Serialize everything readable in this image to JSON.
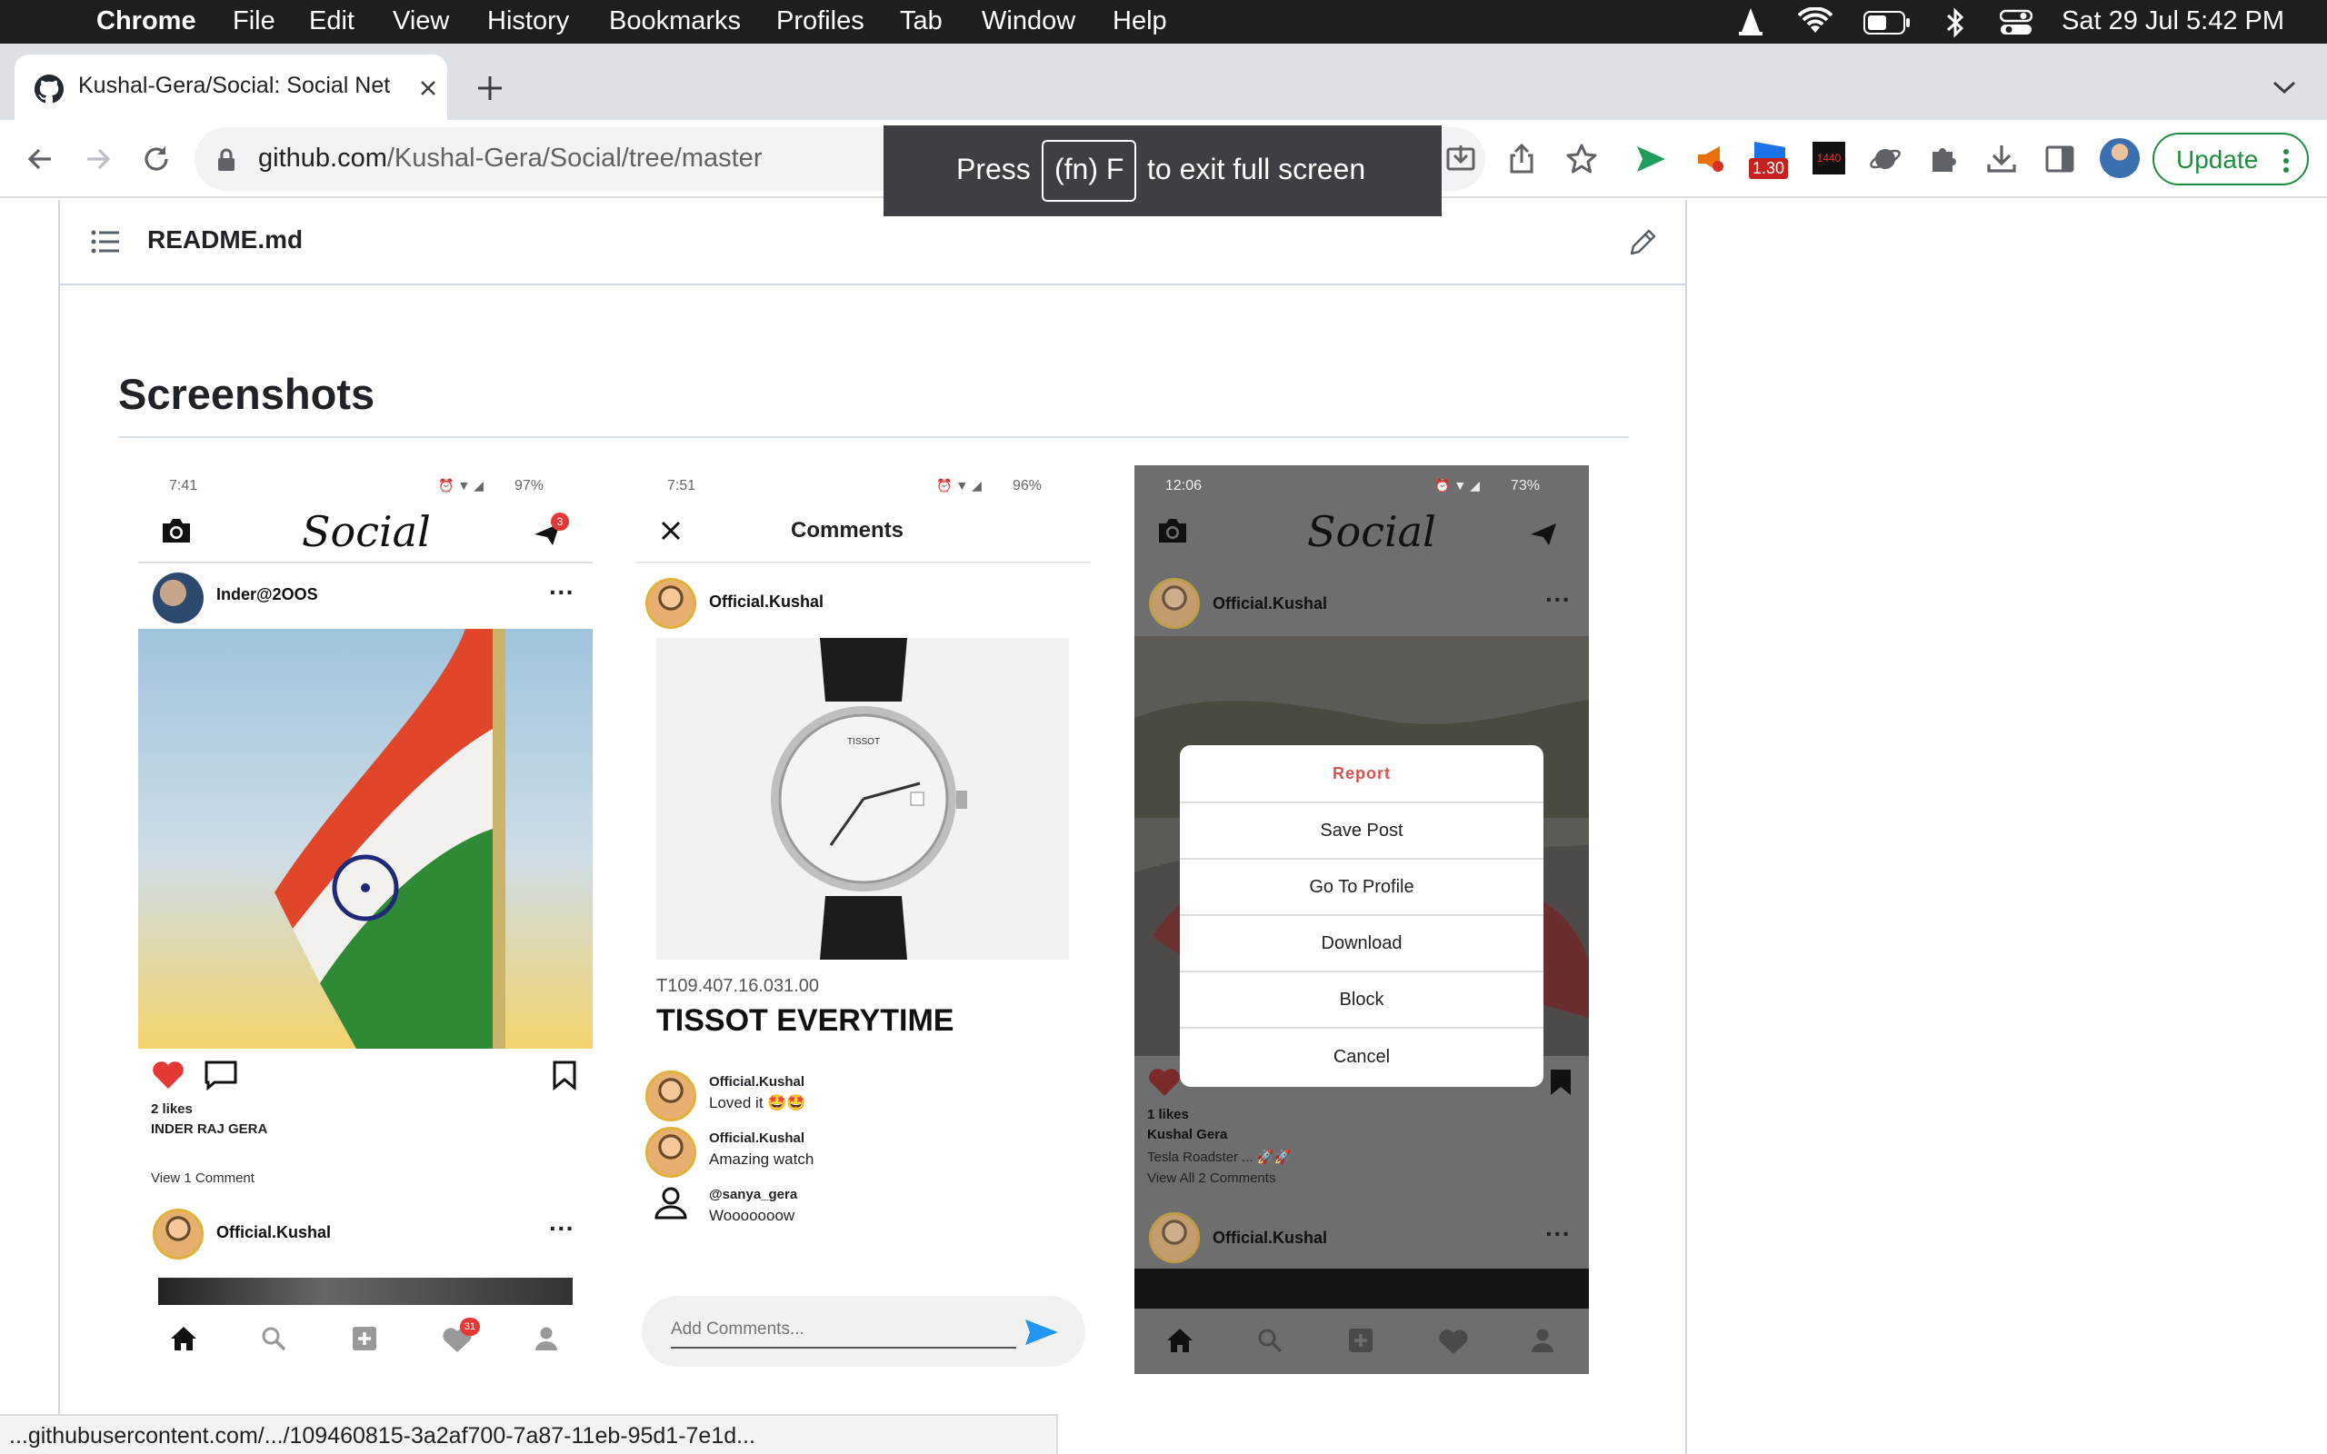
{
  "menubar": {
    "app": "Chrome",
    "items": [
      "File",
      "Edit",
      "View",
      "History",
      "Bookmarks",
      "Profiles",
      "Tab",
      "Window",
      "Help"
    ],
    "clock": "Sat 29 Jul  5:42 PM"
  },
  "tab": {
    "title": "Kushal-Gera/Social: Social Net",
    "new_tab": "+"
  },
  "toolbar": {
    "url_host": "github.com",
    "url_path": "/Kushal-Gera/Social/tree/master",
    "ext_badge": "1.30",
    "ext_1440": "1440",
    "update_label": "Update"
  },
  "fullscreen_toast": {
    "press": "Press",
    "key": "(fn) F",
    "rest": "to exit full screen"
  },
  "readme": {
    "filename": "README.md",
    "heading": "Screenshots"
  },
  "phone1": {
    "time": "7:41",
    "battery": "97%",
    "app_title": "Social",
    "notif_count": "3",
    "post_user": "Inder@2OOS",
    "likes": "2 likes",
    "caption_user": "INDER RAJ GERA",
    "view_comments": "View 1 Comment",
    "post2_user": "Official.Kushal",
    "fav_badge": "31"
  },
  "phone2": {
    "time": "7:51",
    "battery": "96%",
    "title": "Comments",
    "post_user": "Official.Kushal",
    "model": "T109.407.16.031.00",
    "caption": "TISSOT EVERYTIME",
    "comments": [
      {
        "user": "Official.Kushal",
        "text": "Loved it 🤩🤩"
      },
      {
        "user": "Official.Kushal",
        "text": "Amazing watch"
      },
      {
        "user": "@sanya_gera",
        "text": "Wooooooow"
      }
    ],
    "input_placeholder": "Add Comments..."
  },
  "phone3": {
    "time": "12:06",
    "battery": "73%",
    "app_title": "Social",
    "post_user": "Official.Kushal",
    "likes": "1 likes",
    "caption_user": "Kushal Gera",
    "caption": "Tesla Roadster ... 🚀🚀",
    "view_comments": "View All 2 Comments",
    "post2_user": "Official.Kushal",
    "menu": [
      "Report",
      "Save Post",
      "Go To Profile",
      "Download",
      "Block",
      "Cancel"
    ]
  },
  "statusbar": "...githubusercontent.com/.../109460815-3a2af700-7a87-11eb-95d1-7e1d...",
  "colors": {
    "report": "#d9534f",
    "like": "#e53935",
    "send": "#2196f3",
    "update_border": "#1e8e3e"
  }
}
